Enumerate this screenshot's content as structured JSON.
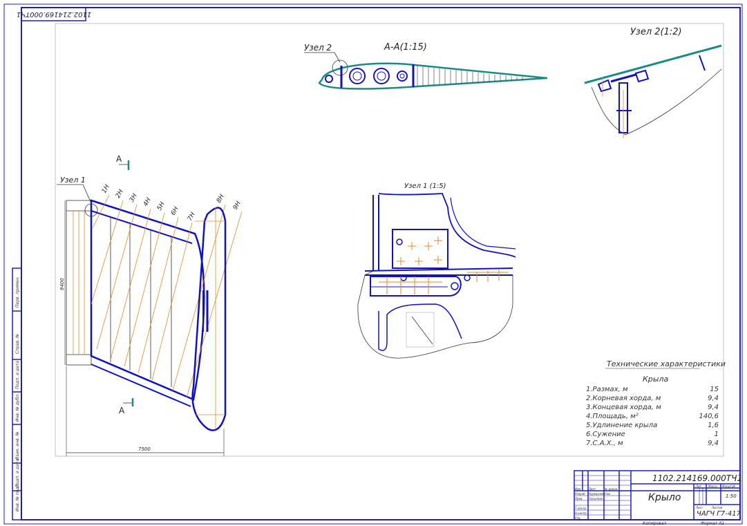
{
  "sheet": {
    "top_code": "1102.214169.000ТЧ1"
  },
  "views": {
    "section_label": "А-А(1:15)",
    "node2_callout": "Узел 2",
    "node2_detail_title": "Узел 2(1:2)",
    "node1_callout": "Узел 1",
    "node1_detail_title": "Узел 1 (1:5)",
    "section_marker_top": "А",
    "section_marker_bottom": "А",
    "dim_span": "7500",
    "dim_chord": "9400",
    "rib_labels": [
      "1Н",
      "2Н",
      "3Н",
      "4Н",
      "5Н",
      "6Н",
      "7Н",
      "8Н",
      "9Н"
    ]
  },
  "specs": {
    "title": "Технические характеристики",
    "subtitle": "Крыла",
    "items": [
      {
        "label": "1.Размах, м",
        "value": "15"
      },
      {
        "label": "2.Корневая хорда, м",
        "value": "9,4"
      },
      {
        "label": "3.Концевая хорда, м",
        "value": "9,4"
      },
      {
        "label": "4.Площадь, м²",
        "value": "140,6"
      },
      {
        "label": "5.Удлинение крыла",
        "value": "1,6"
      },
      {
        "label": "6.Сужение",
        "value": "1"
      },
      {
        "label": "7.С.А.Х., м",
        "value": "9,4"
      }
    ]
  },
  "title_block": {
    "doc_code": "1102.214169.000ТЧ1",
    "name": "Крыло",
    "org": "ЧАГЧ Г7-417",
    "scale": "1:50",
    "lit_header": "Лит.",
    "mass_header": "Масса",
    "scale_header": "Масштаб",
    "sheet_label": "Лист",
    "sheets_label": "Листов",
    "copied": "Копировал",
    "format": "Формат А1",
    "rows": [
      {
        "role": "Изм.",
        "name": "Лист",
        "doc": "№ докум."
      },
      {
        "role": "Разраб.",
        "name": "Нурмухаметов",
        "doc": ""
      },
      {
        "role": "Пров.",
        "name": "Засыпкин",
        "doc": ""
      },
      {
        "role": "Т.контр.",
        "name": "",
        "doc": ""
      },
      {
        "role": "Н.контр.",
        "name": "",
        "doc": ""
      },
      {
        "role": "Утв.",
        "name": "",
        "doc": ""
      }
    ]
  },
  "side_stamps": [
    "Инв. № подл.",
    "Подп. и дата",
    "Взам. инв. №",
    "Инв. № дубл.",
    "Подп. и дата",
    "Справ. №",
    "Перв. примен."
  ],
  "colors": {
    "frame": "#1f1fb4",
    "structure": "#1010c8",
    "centerline": "#e08a2a",
    "skin": "#1a8a84"
  }
}
